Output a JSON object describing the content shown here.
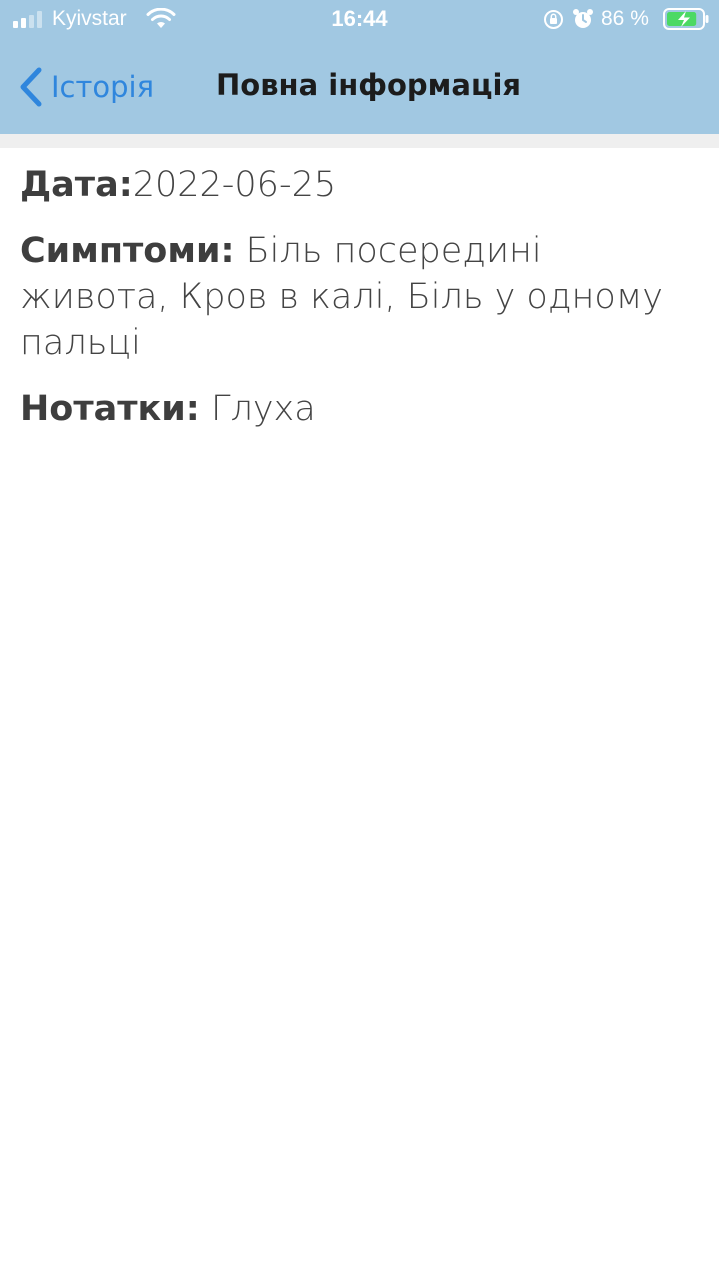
{
  "status_bar": {
    "carrier": "Kyivstar",
    "time": "16:44",
    "battery_percent": "86 %",
    "signal_bars_active": 2,
    "signal_bars_total": 4,
    "battery_level": 0.86,
    "battery_charging": true
  },
  "nav": {
    "back_label": "Історія",
    "title": "Повна інформація"
  },
  "details": {
    "date_label": "Дата:",
    "date_value": "2022-06-25",
    "symptoms_label": "Симптоми:",
    "symptoms_value": "Біль посередині живота, Кров в калі, Біль у одному пальці",
    "notes_label": "Нотатки:",
    "notes_value": "Глуха"
  },
  "colors": {
    "header_bg": "#a1c8e2",
    "accent": "#2f86dd",
    "battery_fill": "#4cd964"
  }
}
